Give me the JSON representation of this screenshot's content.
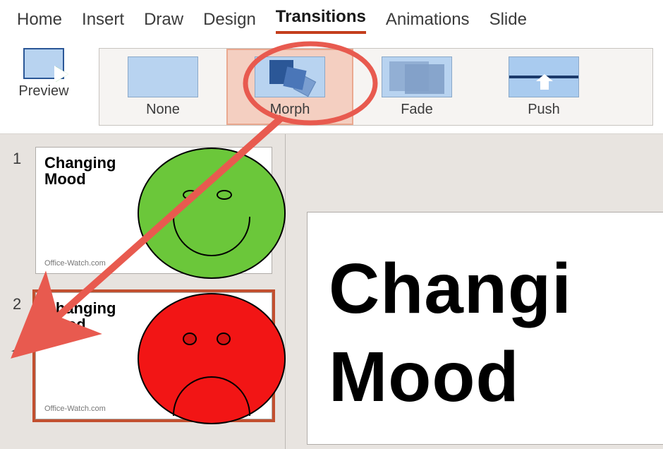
{
  "menu": {
    "items": [
      "Home",
      "Insert",
      "Draw",
      "Design",
      "Transitions",
      "Animations",
      "Slide"
    ],
    "active_index": 4
  },
  "ribbon": {
    "preview_label": "Preview",
    "transitions": [
      {
        "label": "None",
        "kind": "none"
      },
      {
        "label": "Morph",
        "kind": "morph",
        "selected": true
      },
      {
        "label": "Fade",
        "kind": "fade"
      },
      {
        "label": "Push",
        "kind": "push"
      }
    ]
  },
  "thumbnails": [
    {
      "number": "1",
      "title": "Changing Mood",
      "footer": "Office-Watch.com",
      "face": "happy",
      "selected": false,
      "has_transition": false
    },
    {
      "number": "2",
      "title": "Changing Mood",
      "footer": "Office-Watch.com",
      "face": "sad",
      "selected": true,
      "has_transition": true
    }
  ],
  "editor_slide": {
    "title_visible": "Changi\nMood"
  },
  "annotation": {
    "circle_label": "Morph",
    "arrow_target": "slide-2-thumbnail",
    "color": "#e85a4f"
  }
}
